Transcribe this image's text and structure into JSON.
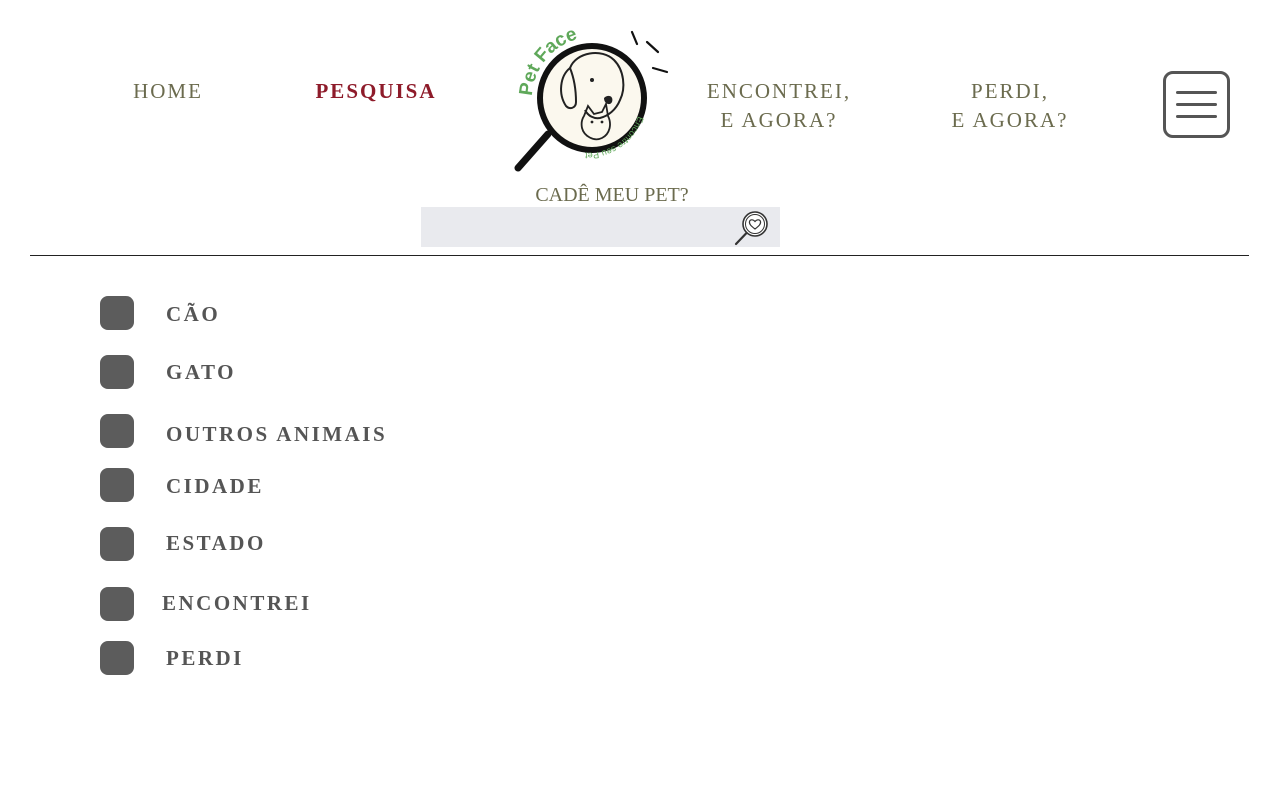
{
  "nav": {
    "home": "HOME",
    "search": "PESQUISA",
    "found_line1": "ENCONTREI,",
    "found_line2": "E AGORA?",
    "lost_line1": "PERDI,",
    "lost_line2": "E AGORA?"
  },
  "logo": {
    "brand": "Pet Face",
    "tagline": "Encontre seu Pet"
  },
  "search": {
    "title": "CADÊ MEU PET?",
    "value": "",
    "placeholder": ""
  },
  "filters": [
    {
      "label": "CÃO"
    },
    {
      "label": "GATO"
    },
    {
      "label": "OUTROS ANIMAIS"
    },
    {
      "label": "CIDADE"
    },
    {
      "label": "ESTADO"
    },
    {
      "label": "ENCONTREI"
    },
    {
      "label": "PERDI"
    }
  ],
  "colors": {
    "nav_text": "#6b6b4e",
    "nav_active": "#8e1b2a",
    "logo_green": "#5fa85a",
    "checkbox": "#5c5c5c",
    "search_bg": "#e9eaee"
  },
  "icons": {
    "menu": "hamburger-menu-icon",
    "search": "magnifier-heart-icon"
  }
}
